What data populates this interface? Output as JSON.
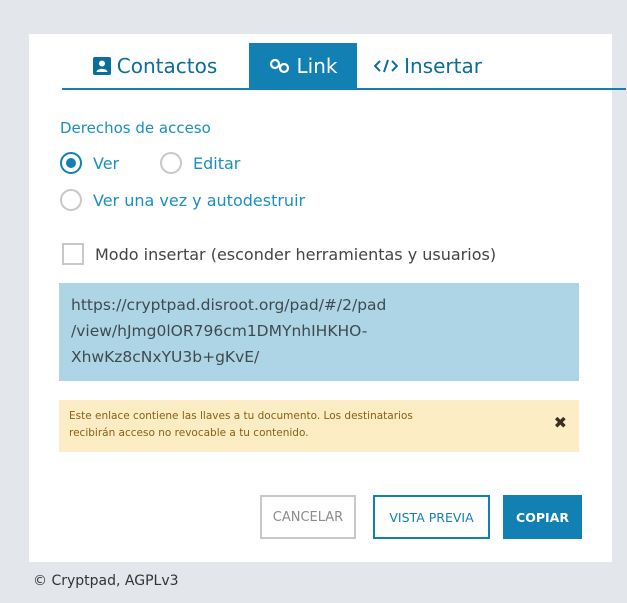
{
  "tabs": {
    "contacts": "Contactos",
    "link": "Link",
    "embed": "Insertar"
  },
  "access": {
    "title": "Derechos de acceso",
    "view": "Ver",
    "edit": "Editar",
    "view_once": "Ver una vez y autodestruir"
  },
  "embed_mode": {
    "label": "Modo insertar (esconder herramientas y usuarios)"
  },
  "link": {
    "line1": "https://cryptpad.disroot.org/pad/#/2/pad",
    "line2": "/view/hJmg0lOR796cm1DMYnhIHKHO-",
    "line3": "XhwKz8cNxYU3b+gKvE/"
  },
  "warning": {
    "line1": "Este enlace contiene las llaves a tu documento. Los destinatarios",
    "line2": "recibirán acceso no revocable a tu contenido.",
    "close": "✖"
  },
  "buttons": {
    "cancel": "CANCELAR",
    "preview": "VISTA PREVIA",
    "copy": "COPIAR"
  },
  "footer": "© Cryptpad, AGPLv3",
  "colors": {
    "accent": "#1280b3",
    "warning_bg": "#fcedc4",
    "link_bg": "#add5e6"
  }
}
